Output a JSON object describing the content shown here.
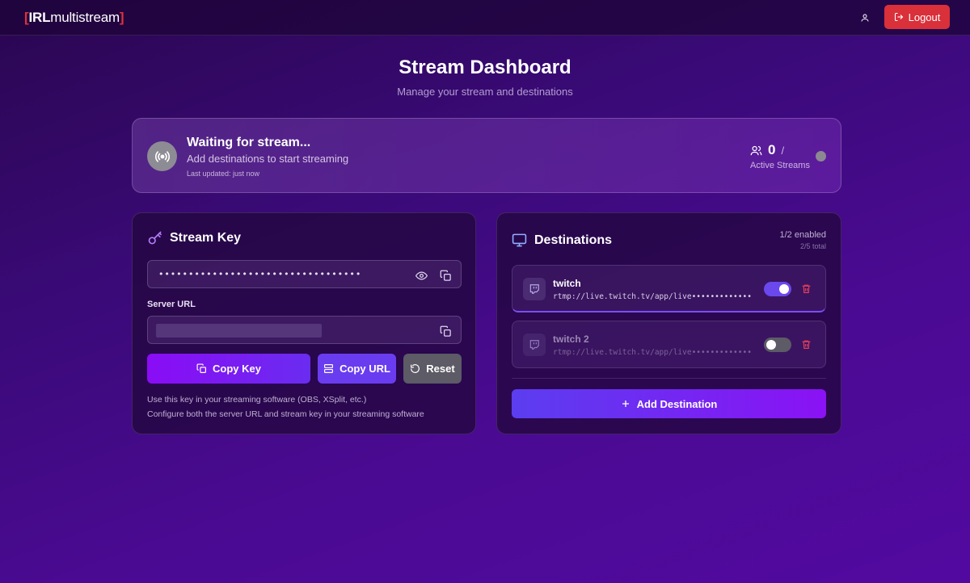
{
  "app": {
    "logo_open": "[",
    "logo_bold": "IRL",
    "logo_rest": "multistream",
    "logo_close": "]"
  },
  "header": {
    "logout_label": "Logout",
    "user_icon": "user-icon",
    "logout_icon": "logout-icon"
  },
  "page": {
    "title": "Stream Dashboard",
    "subtitle": "Manage your stream and destinations"
  },
  "status": {
    "title": "Waiting for stream...",
    "subtitle": "Add destinations to start streaming",
    "last_updated": "Last updated: just now",
    "active_count": "0",
    "active_separator": "/",
    "active_label": "Active Streams",
    "icon": "broadcast-icon",
    "dot_color": "#8b8892"
  },
  "stream_key": {
    "title": "Stream Key",
    "masked_key": "••••••••••••••••••••••••••••••••••",
    "server_url_label": "Server URL",
    "copy_key_label": "Copy Key",
    "copy_url_label": "Copy URL",
    "reset_label": "Reset",
    "help_1": "Use this key in your streaming software (OBS, XSplit, etc.)",
    "help_2": "Configure both the server URL and stream key in your streaming software"
  },
  "destinations": {
    "title": "Destinations",
    "enabled": "1/2 enabled",
    "total": "2/5 total",
    "items": [
      {
        "name": "twitch",
        "url": "rtmp://live.twitch.tv/app/live••••••••••••••••",
        "enabled": true
      },
      {
        "name": "twitch 2",
        "url": "rtmp://live.twitch.tv/app/live••••••••••••••••",
        "enabled": false
      }
    ],
    "add_label": "Add Destination"
  },
  "colors": {
    "accent": "#8a0cf5",
    "logout": "#d9303a",
    "toggle_on": "#6a48ee",
    "trash": "#e0405a"
  }
}
